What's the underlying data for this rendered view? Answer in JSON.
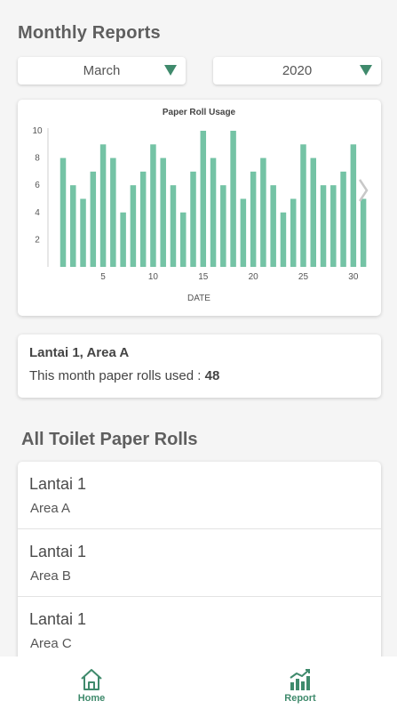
{
  "page": {
    "title": "Monthly Reports"
  },
  "filters": {
    "month": "March",
    "year": "2020"
  },
  "chart_data": {
    "type": "bar",
    "title": "Paper Roll Usage",
    "xlabel": "DATE",
    "ylabel": "",
    "x": [
      1,
      2,
      3,
      4,
      5,
      6,
      7,
      8,
      9,
      10,
      11,
      12,
      13,
      14,
      15,
      16,
      17,
      18,
      19,
      20,
      21,
      22,
      23,
      24,
      25,
      26,
      27,
      28,
      29,
      30,
      31
    ],
    "values": [
      8,
      6,
      5,
      7,
      9,
      8,
      4,
      6,
      7,
      9,
      8,
      6,
      4,
      7,
      10,
      8,
      6,
      10,
      5,
      7,
      8,
      6,
      4,
      5,
      9,
      8,
      6,
      6,
      7,
      9,
      5
    ],
    "x_ticks": [
      5,
      10,
      15,
      20,
      25,
      30
    ],
    "y_ticks": [
      2,
      4,
      6,
      8,
      10
    ],
    "ylim": [
      0,
      10
    ],
    "bar_color": "#74c3a5",
    "grid": false
  },
  "summary": {
    "location": "Lantai 1, Area A",
    "usage_label": "This month paper rolls used :",
    "usage_value": "48"
  },
  "rolls": {
    "title": "All Toilet Paper Rolls",
    "items": [
      {
        "floor": "Lantai 1",
        "area": "Area A"
      },
      {
        "floor": "Lantai 1",
        "area": "Area B"
      },
      {
        "floor": "Lantai 1",
        "area": "Area C"
      }
    ]
  },
  "nav": {
    "home_label": "Home",
    "report_label": "Report"
  },
  "colors": {
    "accent": "#3f8a6c",
    "bar": "#74c3a5"
  }
}
